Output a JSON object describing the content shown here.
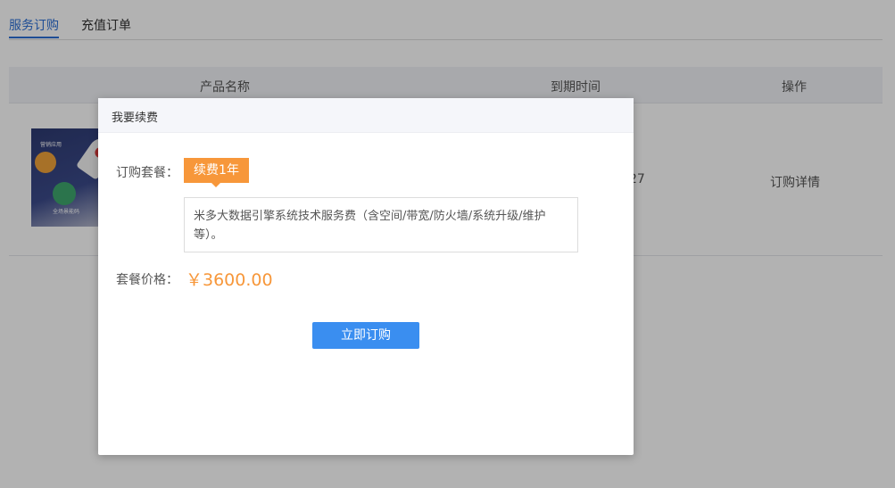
{
  "tabs": [
    {
      "label": "服务订购"
    },
    {
      "label": "充值订单"
    }
  ],
  "table": {
    "headers": [
      "产品名称",
      "到期时间",
      "操作"
    ],
    "row": {
      "thumb_top_text": "营销应用",
      "thumb_bottom_text": "全场景能码",
      "date_partial": "27",
      "action": "订购详情"
    }
  },
  "modal": {
    "title": "我要续费",
    "plan_label": "订购套餐：",
    "plan_option": "续费1年",
    "plan_description": "米多大数据引擎系统技术服务费（含空间/带宽/防火墙/系统升级/维护等）。",
    "price_label": "套餐价格：",
    "price": "￥3600.00",
    "submit_label": "立即订购"
  },
  "colors": {
    "accent_orange": "#f7973a",
    "primary_blue": "#3a8ef0",
    "tab_active_blue": "#2c6fd6"
  }
}
